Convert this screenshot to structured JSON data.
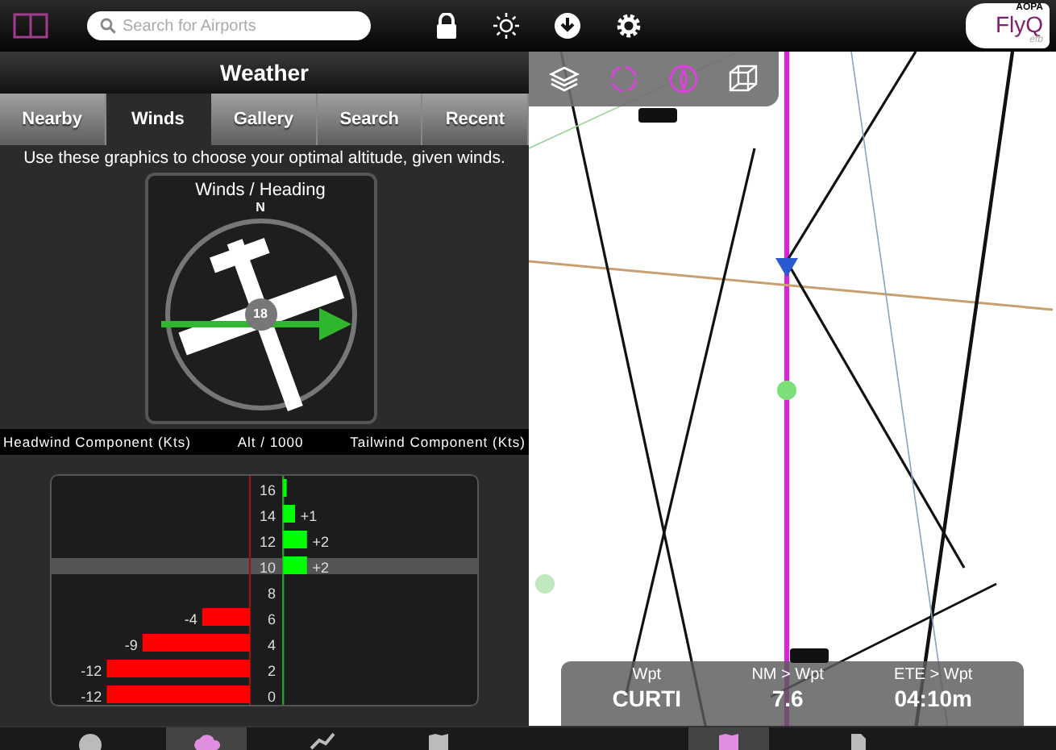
{
  "top_bar": {
    "search": {
      "placeholder": "Search for Airports"
    },
    "logo": {
      "org": "AOPA",
      "name": "FlyQ",
      "suffix": "efb"
    }
  },
  "weather": {
    "title": "Weather",
    "tabs": [
      {
        "label": "Nearby",
        "selected": false
      },
      {
        "label": "Winds",
        "selected": true
      },
      {
        "label": "Gallery",
        "selected": false
      },
      {
        "label": "Search",
        "selected": false
      },
      {
        "label": "Recent",
        "selected": false
      }
    ],
    "description": "Use these graphics to choose your optimal altitude, given winds.",
    "compass": {
      "title": "Winds / Heading",
      "north": "N",
      "wind_speed": "18"
    },
    "headers": [
      "Headwind Component (Kts)",
      "Alt / 1000",
      "Tailwind Component (Kts)"
    ],
    "highlight": "10",
    "charts": [
      {
        "chart_data": {
          "type": "bar",
          "orientation": "horizontal",
          "categories": [
            "16",
            "14",
            "12",
            "10",
            "8",
            "6",
            "4",
            "2",
            "0"
          ],
          "values": [
            null,
            null,
            null,
            null,
            null,
            -4,
            -9,
            -12,
            -12
          ],
          "value_labels": [
            null,
            null,
            null,
            null,
            null,
            "-4",
            "-9",
            "-12",
            "-12"
          ]
        }
      },
      {
        "chart_data": {
          "type": "bar",
          "orientation": "horizontal",
          "categories": [
            null,
            null,
            null,
            null,
            null,
            null,
            null,
            null,
            null
          ],
          "values": [
            0.3,
            1,
            2,
            2,
            0,
            null,
            null,
            null,
            null
          ],
          "value_labels": [
            null,
            "+1",
            "+2",
            "+2",
            null,
            null,
            null,
            null,
            null
          ]
        }
      }
    ]
  },
  "left_tabbar": [
    {
      "kind": "location",
      "selected": false
    },
    {
      "kind": "cloud",
      "selected": true
    },
    {
      "kind": "route",
      "selected": false
    },
    {
      "kind": "map",
      "selected": false
    }
  ],
  "map_toolbar": [
    {
      "kind": "layers"
    },
    {
      "kind": "recenter"
    },
    {
      "kind": "compass"
    },
    {
      "kind": "cube"
    }
  ],
  "nav_info": [
    {
      "label": "Wpt",
      "value": "CURTI"
    },
    {
      "label": "NM > Wpt",
      "value": "7.6"
    },
    {
      "label": "ETE > Wpt",
      "value": "04:10m"
    }
  ],
  "right_tabbar": [
    {
      "kind": "map",
      "selected": true
    },
    {
      "kind": "document",
      "selected": false
    }
  ]
}
